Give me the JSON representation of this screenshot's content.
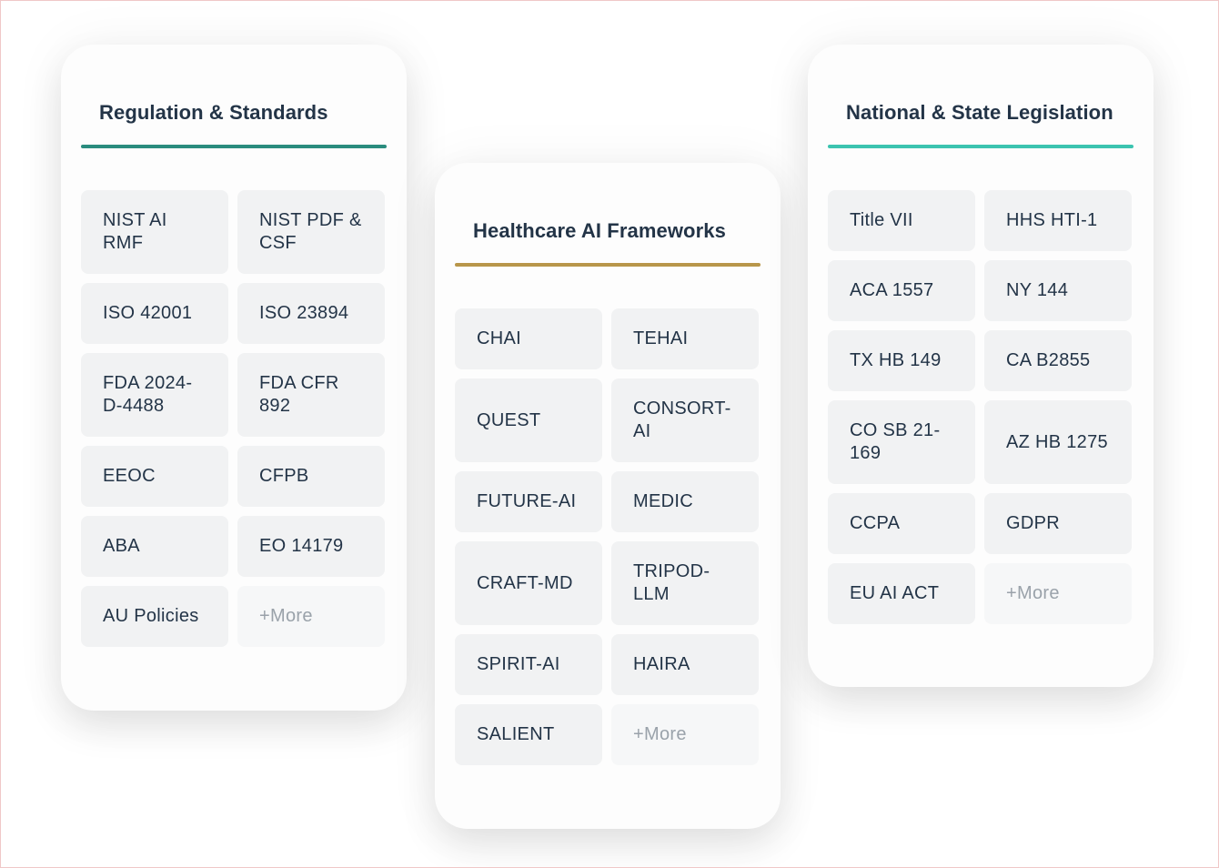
{
  "cards": [
    {
      "title": "Regulation & Standards",
      "accent": "#2a8c7e",
      "items": [
        "NIST AI RMF",
        "NIST PDF & CSF",
        "ISO 42001",
        "ISO 23894",
        "FDA 2024-D-4488",
        "FDA CFR 892",
        "EEOC",
        "CFPB",
        "ABA",
        "EO 14179",
        "AU Policies",
        "+More"
      ]
    },
    {
      "title": "Healthcare AI Frameworks",
      "accent": "#b8964a",
      "items": [
        "CHAI",
        "TEHAI",
        "QUEST",
        "CONSORT-AI",
        "FUTURE-AI",
        "MEDIC",
        "CRAFT-MD",
        "TRIPOD-LLM",
        "SPIRIT-AI",
        "HAIRA",
        "SALIENT",
        "+More"
      ]
    },
    {
      "title": "National & State Legislation",
      "accent": "#3cc4b0",
      "items": [
        "Title VII",
        "HHS HTI-1",
        "ACA 1557",
        "NY 144",
        "TX HB 149",
        "CA B2855",
        "CO SB 21-169",
        "AZ HB 1275",
        "CCPA",
        "GDPR",
        "EU AI ACT",
        "+More"
      ]
    }
  ]
}
